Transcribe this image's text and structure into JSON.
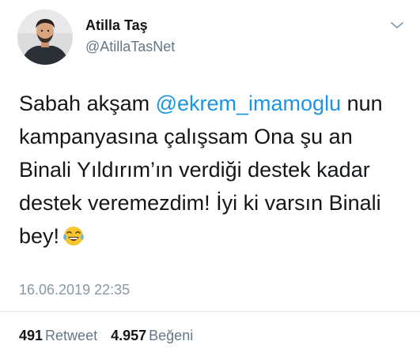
{
  "user": {
    "display_name": "Atilla Taş",
    "handle": "@AtillaTasNet",
    "avatar_icon": "profile-photo"
  },
  "menu_icon": "chevron-down-icon",
  "tweet": {
    "line1_prefix": "Sabah akşam ",
    "mention": "@ekrem_imamoglu",
    "line1_suffix": " nun",
    "line2": "kampanyasına çalışsam Ona şu an",
    "line3": "Binali Yıldırım’ın verdiği destek kadar",
    "line4": "destek veremezdim! İyi ki varsın Binali",
    "line5": "bey!",
    "emoji": "face-with-tears-of-joy",
    "timestamp": "16.06.2019 22:35"
  },
  "stats": {
    "retweets_count": "491",
    "retweets_label": "Retweet",
    "likes_count": "4.957",
    "likes_label": "Beğeni"
  },
  "colors": {
    "link": "#1b95e0",
    "text": "#14171a",
    "muted": "#657786",
    "divider": "#e1e8ed"
  }
}
